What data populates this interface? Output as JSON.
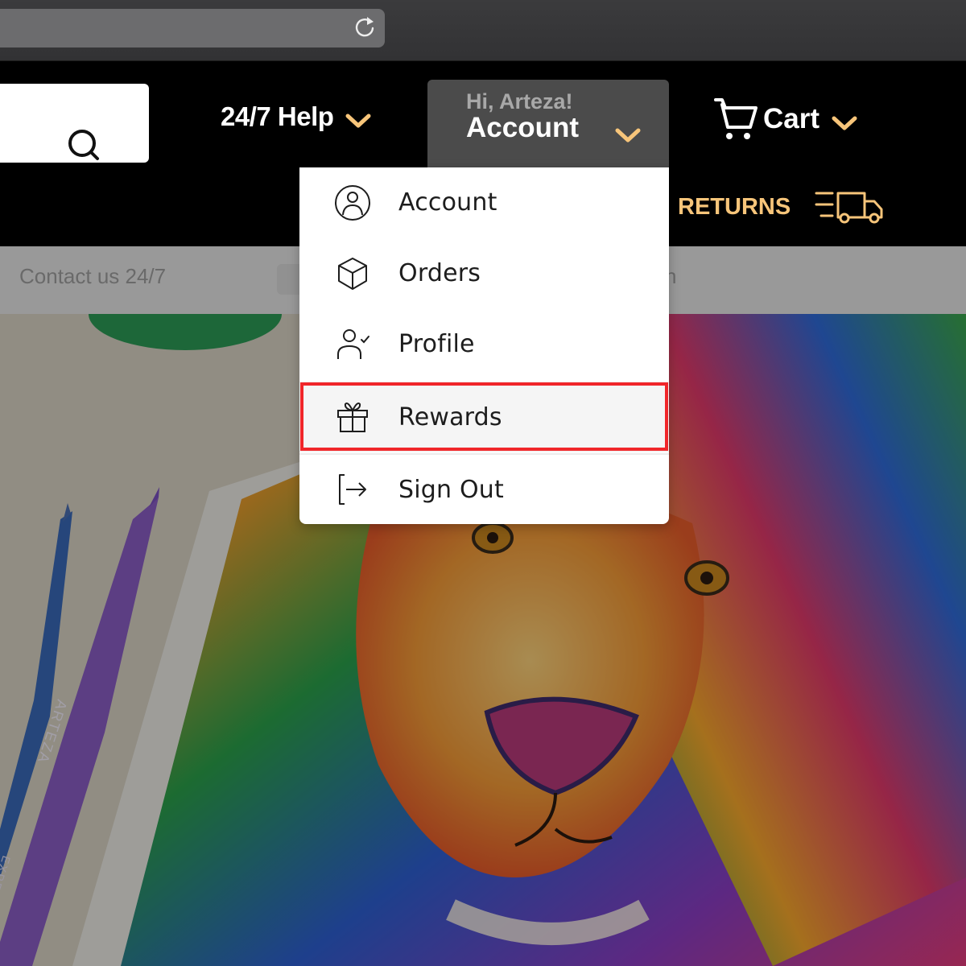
{
  "browser": {
    "reload_icon": "reload-icon"
  },
  "header": {
    "search_icon": "search-icon",
    "help_label": "24/7 Help",
    "account_greeting": "Hi, Arteza!",
    "account_label": "Account",
    "cart_label": "Cart",
    "returns_label": "RETURNS",
    "accent_color": "#f7c57a"
  },
  "subnav": {
    "contact_label": "Contact us 24/7",
    "trailing_text": "n"
  },
  "account_menu": {
    "items": [
      {
        "label": "Account",
        "icon": "user-circle-icon"
      },
      {
        "label": "Orders",
        "icon": "box-icon"
      },
      {
        "label": "Profile",
        "icon": "user-check-icon"
      },
      {
        "label": "Rewards",
        "icon": "gift-icon",
        "highlighted": true
      },
      {
        "label": "Sign Out",
        "icon": "sign-out-icon"
      }
    ],
    "highlight_color": "#f0262a"
  },
  "hero": {
    "pencil_brand": "ARTEZA",
    "pencil_line": "EXPERT"
  }
}
